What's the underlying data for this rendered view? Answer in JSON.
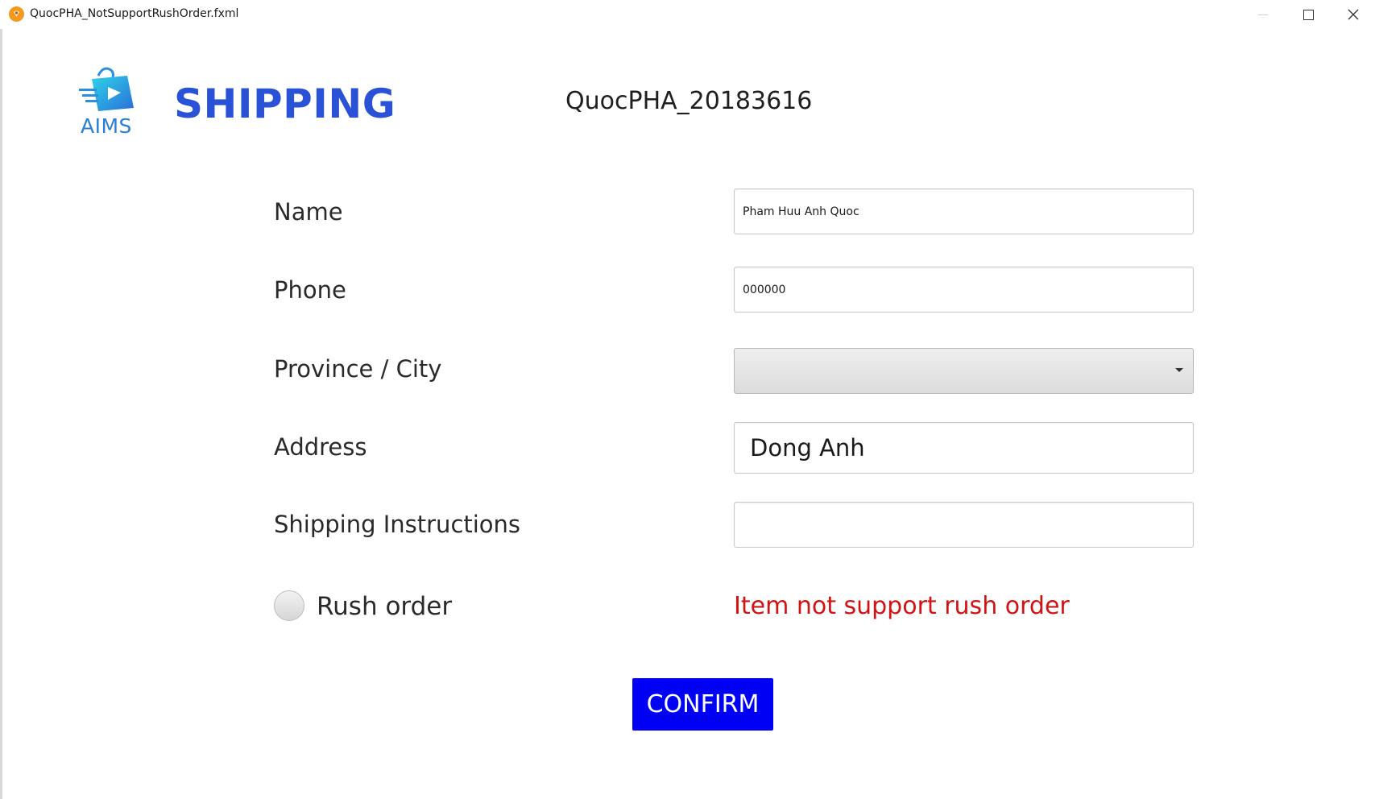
{
  "window": {
    "title": "QuocPHA_NotSupportRushOrder.fxml",
    "controls": {
      "minimize_icon": "minimize-icon",
      "maximize_icon": "maximize-icon",
      "close_icon": "close-icon"
    }
  },
  "header": {
    "logo_text": "AIMS",
    "title": "SHIPPING",
    "student_id": "QuocPHA_20183616"
  },
  "form": {
    "name_label": "Name",
    "name_value": "Pham Huu Anh Quoc",
    "phone_label": "Phone",
    "phone_value": "000000",
    "province_label": "Province / City",
    "province_value": "",
    "address_label": "Address",
    "address_value": "Dong Anh",
    "instructions_label": "Shipping Instructions",
    "instructions_value": "",
    "rush_label": "Rush order",
    "rush_checked": false,
    "rush_warning": "Item not support rush order",
    "confirm_label": "CONFIRM"
  },
  "colors": {
    "title": "#2a52d6",
    "warning": "#d11313",
    "confirm_bg": "#0000f5",
    "logo": "#2a7fd6"
  }
}
